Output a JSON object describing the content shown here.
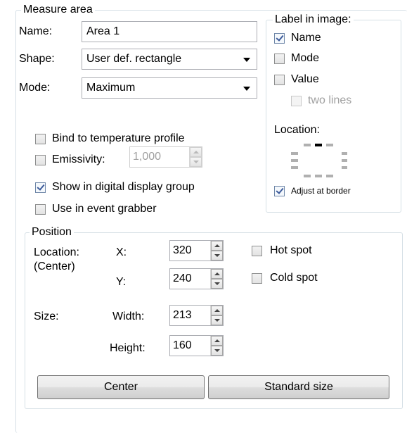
{
  "measure_area": {
    "title": "Measure area",
    "name_label": "Name:",
    "name_value": "Area 1",
    "shape_label": "Shape:",
    "shape_value": "User def. rectangle",
    "mode_label": "Mode:",
    "mode_value": "Maximum"
  },
  "label_in_image": {
    "title": "Label in image:",
    "name": {
      "label": "Name",
      "checked": true
    },
    "mode": {
      "label": "Mode",
      "checked": false
    },
    "value": {
      "label": "Value",
      "checked": false
    },
    "two_lines": {
      "label": "two lines",
      "checked": false,
      "enabled": false
    },
    "location_label": "Location:",
    "adjust_at_border": {
      "label": "Adjust at border",
      "checked": true
    }
  },
  "options": {
    "bind_profile": {
      "label": "Bind to temperature profile",
      "checked": false
    },
    "emissivity": {
      "label": "Emissivity:",
      "checked": false,
      "value": "1,000"
    },
    "show_digital": {
      "label": "Show in digital display group",
      "checked": true
    },
    "event_grabber": {
      "label": "Use in event grabber",
      "checked": false
    }
  },
  "position": {
    "title": "Position",
    "location_label": "Location:",
    "center_label": "(Center)",
    "x_label": "X:",
    "x_value": "320",
    "y_label": "Y:",
    "y_value": "240",
    "size_label": "Size:",
    "width_label": "Width:",
    "width_value": "213",
    "height_label": "Height:",
    "height_value": "160",
    "hot_spot": {
      "label": "Hot spot",
      "checked": false
    },
    "cold_spot": {
      "label": "Cold spot",
      "checked": false
    },
    "center_button": "Center",
    "standard_size_button": "Standard size"
  }
}
